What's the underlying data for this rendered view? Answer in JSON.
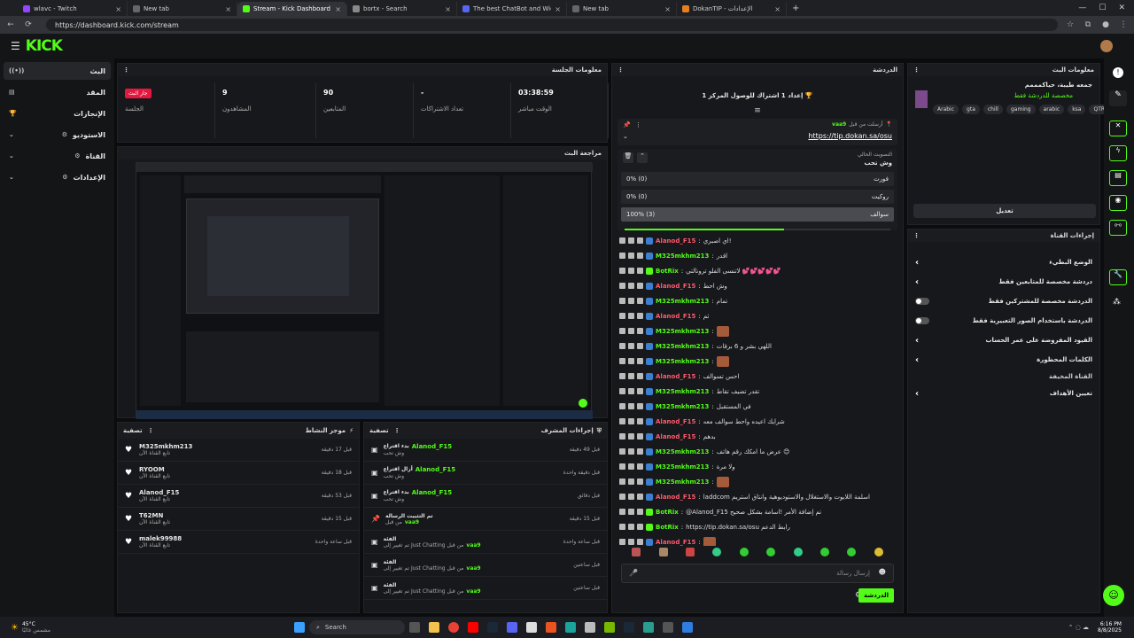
{
  "browser": {
    "tabs": [
      {
        "label": "wlavc - Twitch",
        "color": "#9146ff"
      },
      {
        "label": "New tab",
        "color": "#666"
      },
      {
        "label": "Stream - Kick Dashboard",
        "color": "#53fc18"
      },
      {
        "label": "bortx - Search",
        "color": "#888"
      },
      {
        "label": "The best ChatBot and Widgets fo",
        "color": "#5865f2"
      },
      {
        "label": "New tab",
        "color": "#666"
      },
      {
        "label": "DokanTIP - الإعدادات",
        "color": "#e67e22"
      }
    ],
    "url": "https://dashboard.kick.com/stream"
  },
  "kick": {
    "logo": "KICK"
  },
  "sidebar": {
    "items": [
      {
        "label": "البث",
        "icon": "broadcast-icon"
      },
      {
        "label": "المقد",
        "icon": "content-icon"
      },
      {
        "label": "الإنجازات",
        "icon": "trophy-icon"
      },
      {
        "label": "الاستوديو",
        "icon": "studio-icon"
      },
      {
        "label": "القناة",
        "icon": "channel-icon"
      },
      {
        "label": "الإعدادات",
        "icon": "settings-icon"
      }
    ]
  },
  "session": {
    "title": "معلومات الجلسة",
    "live_badge": "جار البث",
    "session_label": "الجلسة",
    "stats": [
      {
        "value": "9",
        "label": "المشاهدون"
      },
      {
        "value": "90",
        "label": "المتابعين"
      },
      {
        "value": "-",
        "label": "تعداد الاشتراكات"
      },
      {
        "value": "03:38:59",
        "label": "الوقت مباشر"
      }
    ]
  },
  "preview": {
    "title": "مراجعة البث"
  },
  "activity": {
    "title": "موجز النشاط",
    "filter": "تصفية",
    "items": [
      {
        "user": "M325mkhm213",
        "sub": "تابع القناة الآن",
        "time": "قبل 17 دقيقة"
      },
      {
        "user": "RYOOM",
        "sub": "تابع القناة الآن",
        "time": "قبل 18 دقيقة"
      },
      {
        "user": "Alanod_F15",
        "sub": "تابع القناة الآن",
        "time": "قبل 53 دقيقة"
      },
      {
        "user": "T62MN",
        "sub": "تابع القناة الآن",
        "time": "قبل 15 دقيقة"
      },
      {
        "user": "malek99988",
        "sub": "تابع القناة الآن",
        "time": "قبل ساعة واحدة"
      }
    ]
  },
  "mod": {
    "title": "إجراءات المشرف",
    "filter": "تصفية",
    "items": [
      {
        "user": "Alanod_F15",
        "action": "بدء اقتراع",
        "sub": "وش تحب",
        "time": "قبل 49 دقيقة"
      },
      {
        "user": "Alanod_F15",
        "action": "أزال اقتراع",
        "sub": "وش تحب",
        "time": "قبل دقيقة واحدة"
      },
      {
        "user": "Alanod_F15",
        "action": "بدء اقتراع",
        "sub": "وش تحب",
        "time": "قبل دقائق"
      },
      {
        "user": "vaa9",
        "action": "تم التثبيت الرسالة",
        "sub": "من قبل",
        "time": "قبل 15 دقيقة"
      },
      {
        "user": "vaa9",
        "action": "الفئة",
        "sub": "تم تغيير إلى Just Chatting من قبل",
        "time": "قبل ساعة واحدة"
      },
      {
        "user": "vaa9",
        "action": "الفئة",
        "sub": "تم تغيير إلى Just Chatting من قبل",
        "time": "قبل ساعتين"
      },
      {
        "user": "vaa9",
        "action": "الفئة",
        "sub": "تم تغيير إلى Just Chatting من قبل",
        "time": "قبل ساعتين"
      }
    ]
  },
  "chat": {
    "title": "الدردشة",
    "goal": "إعداد 1 اشتراك للوصول المركز 1 🏆",
    "pinned_by": "أرسلت من قبل",
    "pinned_user": "vaa9",
    "pinned_link": "https://tip.dokan.sa/osu",
    "poll_label": "التصويت الحالي",
    "poll_question": "وش تحب",
    "poll_options": [
      {
        "label": "فورت",
        "pct": "0% (0)"
      },
      {
        "label": "روكيت",
        "pct": "0% (0)"
      },
      {
        "label": "سوالف",
        "pct": "100% (3)"
      }
    ],
    "poll_progress": 0.6,
    "messages": [
      {
        "user": "Alanod_F15",
        "color": "#ff5a6b",
        "text": "اي اصبري!"
      },
      {
        "user": "M325mkhm213",
        "color": "#53fc18",
        "text": "اقدر"
      },
      {
        "user": "BotRix",
        "color": "#53fc18",
        "text": "لاتنسى الفلو ترونالتي 💕💕💕💕💕"
      },
      {
        "user": "Alanod_F15",
        "color": "#ff5a6b",
        "text": "وش احط"
      },
      {
        "user": "M325mkhm213",
        "color": "#53fc18",
        "text": "تمام"
      },
      {
        "user": "Alanod_F15",
        "color": "#ff5a6b",
        "text": "ثم"
      },
      {
        "user": "M325mkhm213",
        "color": "#53fc18",
        "text": ""
      },
      {
        "user": "M325mkhm213",
        "color": "#53fc18",
        "text": "اللهي بشر و 6 برقات"
      },
      {
        "user": "M325mkhm213",
        "color": "#53fc18",
        "text": ""
      },
      {
        "user": "Alanod_F15",
        "color": "#ff5a6b",
        "text": "احس تسوالف"
      },
      {
        "user": "M325mkhm213",
        "color": "#53fc18",
        "text": "تقدر تضيف تقاط"
      },
      {
        "user": "M325mkhm213",
        "color": "#53fc18",
        "text": "في المستقبل"
      },
      {
        "user": "Alanod_F15",
        "color": "#ff5a6b",
        "text": "شرايك اعيده واحط سوالف معه"
      },
      {
        "user": "Alanod_F15",
        "color": "#ff5a6b",
        "text": "بدهم"
      },
      {
        "user": "M325mkhm213",
        "color": "#53fc18",
        "text": "عرض ما امكك رقم هاتف 😊"
      },
      {
        "user": "M325mkhm213",
        "color": "#53fc18",
        "text": "ولا مرة"
      },
      {
        "user": "M325mkhm213",
        "color": "#53fc18",
        "text": ""
      },
      {
        "user": "Alanod_F15",
        "color": "#ff5a6b",
        "text": "laddcom اسلمة اللايوت والاستغلال والاستوديوهية وانتاق استريم"
      },
      {
        "user": "BotRix",
        "color": "#53fc18",
        "text": "@Alanod_F15 تم إضافة الأمر !اسامة بشكل صحيح"
      },
      {
        "user": "BotRix",
        "color": "#53fc18",
        "text": "https://tip.dokan.sa/osu رابط الدعم"
      },
      {
        "user": "Alanod_F15",
        "color": "#ff5a6b",
        "text": ""
      }
    ],
    "input_placeholder": "إرسال رسالة",
    "send_label": "الدردشة"
  },
  "stream_info": {
    "title": "معلومات البث",
    "stream_title": "جمعه طيبة، حياكمممم",
    "category": "مخصصة للدردشة فقط",
    "tags": [
      "Arabic",
      "gta",
      "chill",
      "gaming",
      "arabic",
      "ksa",
      "QTR"
    ],
    "edit_label": "تعديل"
  },
  "channel_actions": {
    "title": "إجراءات القناة",
    "rows": [
      {
        "label": "الوضع البطيء",
        "control": "arrow"
      },
      {
        "label": "دردشة مخصصة للمتابعين فقط",
        "control": "arrow"
      },
      {
        "label": "الدردشة مخصصة للمشتركين فقط",
        "control": "toggle"
      },
      {
        "label": "الدردشة باستخدام الصور التعبيرية فقط",
        "control": "toggle"
      },
      {
        "label": "القيود المفروضة على عمر الحساب",
        "control": "arrow"
      },
      {
        "label": "الكلمات المحظورة",
        "control": "arrow"
      }
    ],
    "section": "القناة المخيفة",
    "goals": "تعيين الأهداف"
  },
  "taskbar": {
    "temp": "45°C",
    "weather": "مشمس غالبًا",
    "search": "Search",
    "time": "6:16 PM",
    "date": "8/8/2025"
  }
}
